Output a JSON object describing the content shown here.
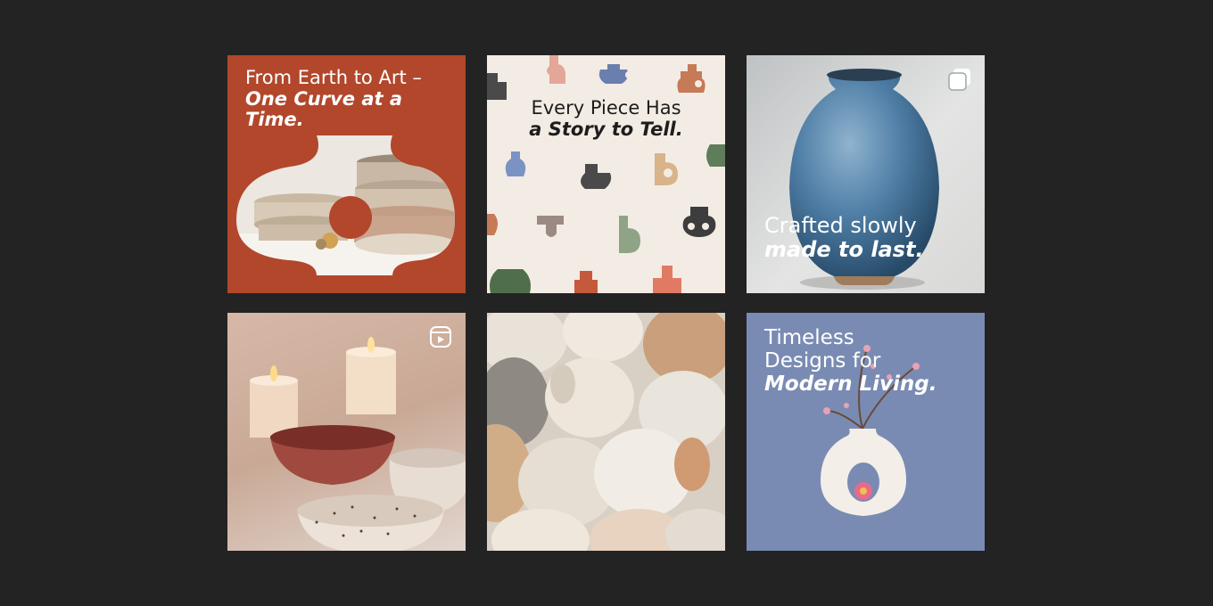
{
  "posts": [
    {
      "line1": "From Earth to Art –",
      "line2": "One Curve at a Time."
    },
    {
      "line1": "Every Piece Has",
      "line2": "a Story to Tell."
    },
    {
      "line1": "Crafted slowly",
      "line2": "made to last.",
      "badge_icon": "carousel-icon"
    },
    {
      "badge_icon": "reels-icon"
    },
    {},
    {
      "line1": "Timeless",
      "line1b": "Designs for",
      "line2": "Modern Living."
    }
  ],
  "colors": {
    "background": "#232323",
    "terracotta": "#b2472b",
    "cream": "#f3ece4",
    "periwinkle": "#7a8bb3"
  }
}
